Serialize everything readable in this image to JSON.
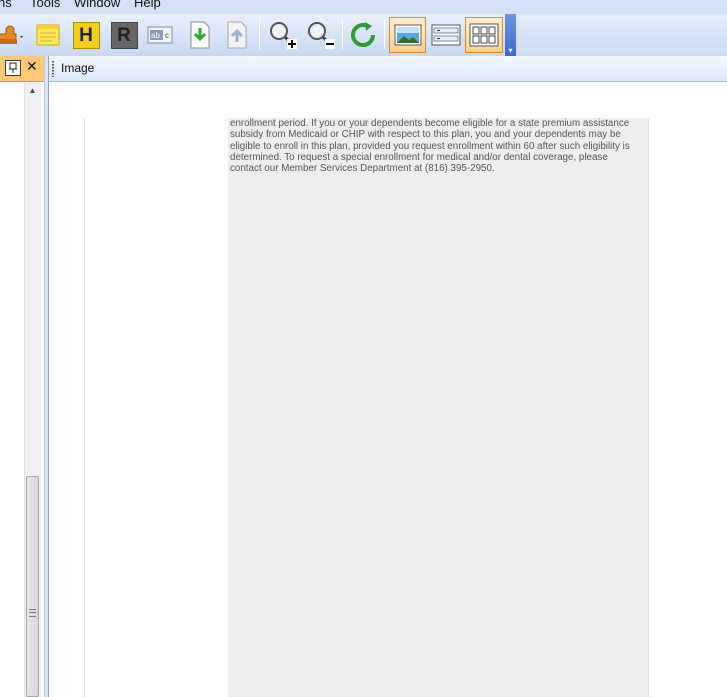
{
  "menu": {
    "items": [
      "ns",
      "Tools",
      "Window",
      "Help"
    ]
  },
  "toolbar": {
    "buttons": [
      {
        "name": "stamp",
        "icon": "stamp-icon"
      },
      {
        "name": "note",
        "icon": "sticky-note-icon"
      },
      {
        "name": "highlight",
        "icon": "highlight-icon",
        "letter": "H"
      },
      {
        "name": "redact",
        "icon": "redact-icon",
        "letter": "R"
      },
      {
        "name": "ocr",
        "icon": "ocr-text-icon"
      },
      {
        "name": "download",
        "icon": "download-icon"
      },
      {
        "name": "upload",
        "icon": "upload-icon"
      },
      {
        "name": "zoom-in",
        "icon": "zoom-in-icon"
      },
      {
        "name": "zoom-out",
        "icon": "zoom-out-icon"
      },
      {
        "name": "refresh",
        "icon": "refresh-icon"
      },
      {
        "name": "image-view",
        "icon": "image-view-icon",
        "active": true
      },
      {
        "name": "list-view",
        "icon": "list-view-icon",
        "active": false
      },
      {
        "name": "thumbnail-view",
        "icon": "thumbnail-view-icon",
        "active": true
      }
    ],
    "colors": {
      "active_border": "#e08a2a",
      "bar": "#c6d8f2"
    }
  },
  "left_pane": {
    "pin_label": "❁",
    "close_label": "✕",
    "header_color": "#ffc776"
  },
  "image_pane": {
    "title": "Image",
    "document_lines": [
      "enrollment period. If you or your dependents become eligible for a state premium assistance",
      "subsidy from Medicaid or CHIP with respect to this plan, you and your dependents may be",
      "eligible to enroll in this plan, provided you request enrollment within 60 after such eligibility is",
      "determined. To request a special enrollment for medical and/or dental coverage, please",
      "contact our Member Services Department at (816) 395-2950."
    ]
  }
}
